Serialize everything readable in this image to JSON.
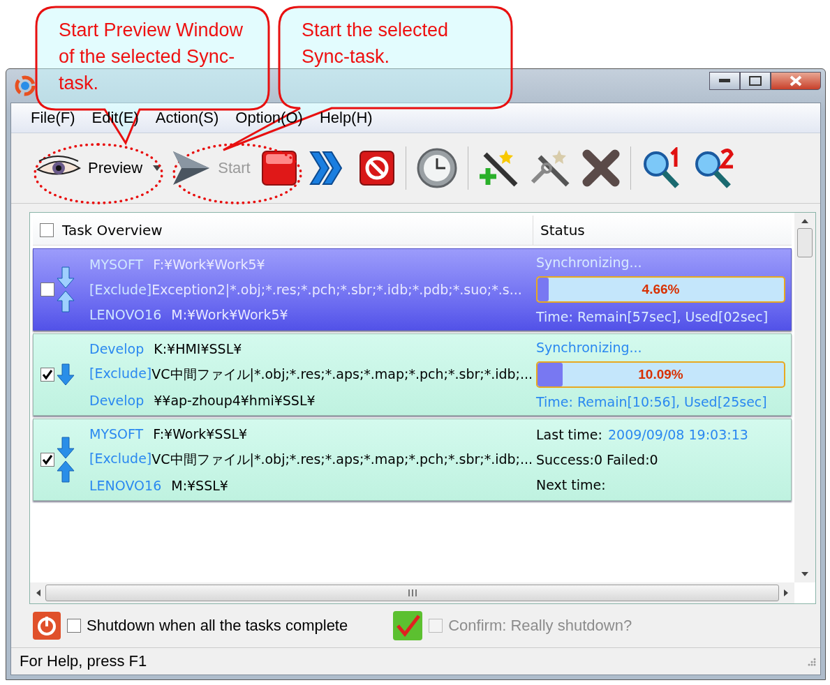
{
  "callouts": [
    {
      "text": "Start Preview Window of the selected Sync-task."
    },
    {
      "text": "Start the selected Sync-task."
    }
  ],
  "menu": [
    {
      "label": "File(F)"
    },
    {
      "label": "Edit(E)"
    },
    {
      "label": "Action(S)"
    },
    {
      "label": "Option(O)"
    },
    {
      "label": "Help(H)"
    }
  ],
  "toolbar": {
    "preview_button": {
      "label": "Preview"
    },
    "start_button": {
      "label": "Start",
      "disabled": true
    }
  },
  "task_list": {
    "columns": [
      "Task Overview",
      "Status"
    ],
    "all_checked": false,
    "tasks": [
      {
        "selected": true,
        "checked": false,
        "kind": "both",
        "source": {
          "name": "MYSOFT",
          "path": "F:¥Work¥Work5¥"
        },
        "exclude_label": "[Exclude]",
        "exclude": "Exception2|*.obj;*.res;*.pch;*.sbr;*.idb;*.pdb;*.suo;*.s...",
        "target": {
          "name": "LENOVO16",
          "path": "M:¥Work¥Work5¥"
        },
        "status": {
          "kind": "progress",
          "text": "Synchronizing...",
          "level": 0.0466,
          "reading": "4.66%",
          "time": "Time: Remain[57sec], Used[02sec]"
        }
      },
      {
        "selected": false,
        "checked": true,
        "kind": "down",
        "source": {
          "name": "Develop",
          "path": "K:¥HMI¥SSL¥"
        },
        "exclude_label": "[Exclude]",
        "exclude": "VC中間ファイル|*.obj;*.res;*.aps;*.map;*.pch;*.sbr;*.idb;...",
        "target": {
          "name": "Develop",
          "path": "¥¥ap-zhoup4¥hmi¥SSL¥"
        },
        "status": {
          "kind": "progress",
          "text": "Synchronizing...",
          "level": 0.1009,
          "reading": "10.09%",
          "time": "Time: Remain[10:56], Used[25sec]"
        }
      },
      {
        "selected": false,
        "checked": true,
        "kind": "both",
        "source": {
          "name": "MYSOFT",
          "path": "F:¥Work¥SSL¥"
        },
        "exclude_label": "[Exclude]",
        "exclude": "VC中間ファイル|*.obj;*.res;*.aps;*.map;*.pch;*.sbr;*.idb;...",
        "target": {
          "name": "LENOVO16",
          "path": "M:¥SSL¥"
        },
        "status": {
          "kind": "schedule",
          "last_label": "Last time:",
          "last_value": "2009/09/08 19:03:13",
          "counts": "Success:0 Failed:0",
          "next_label": "Next time:"
        }
      }
    ]
  },
  "options": {
    "shutdown": {
      "label": "Shutdown when all the tasks complete",
      "checked": false
    },
    "confirm": {
      "label": "Confirm: Really shutdown?",
      "checked": false,
      "disabled": true
    }
  },
  "status_bar": "For Help, press F1"
}
